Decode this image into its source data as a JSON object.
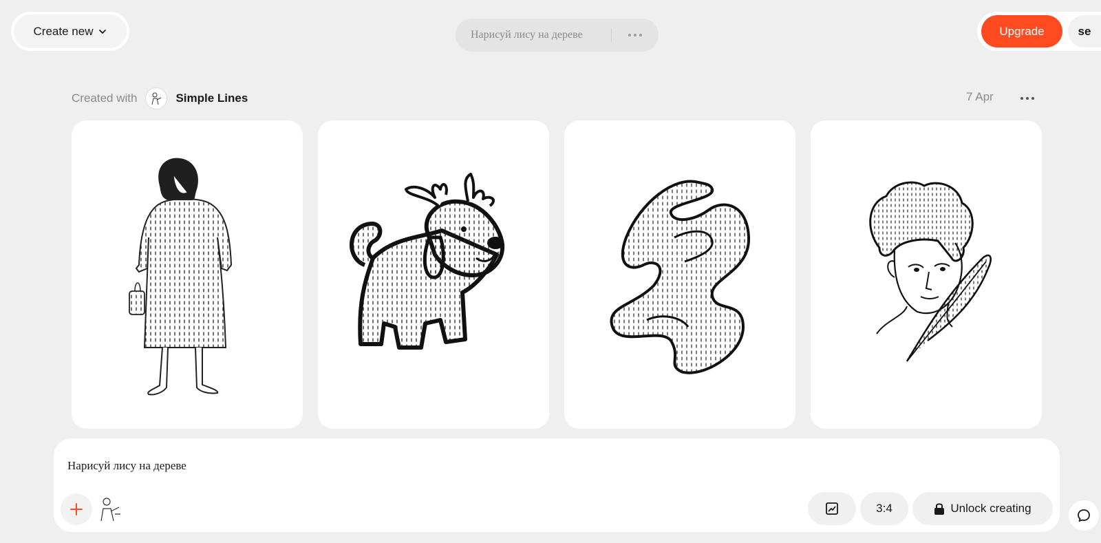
{
  "header": {
    "create_new_label": "Create new",
    "prompt_preview": "Нарисуй лису на дереве",
    "upgrade_label": "Upgrade",
    "user_initials": "se"
  },
  "generation": {
    "created_with_label": "Created with",
    "style_name": "Simple Lines",
    "date": "7 Apr"
  },
  "images": [
    {
      "subject": "woman in dotted dress holding bag"
    },
    {
      "subject": "dotted dog with antlers"
    },
    {
      "subject": "abstract dotted squiggle shape"
    },
    {
      "subject": "curly-haired woman portrait with leaf"
    }
  ],
  "composer": {
    "prompt_text": "Нарисуй лису на дереве",
    "aspect_ratio": "3:4",
    "unlock_label": "Unlock creating"
  },
  "colors": {
    "accent": "#ff4b1f",
    "background": "#efefef"
  },
  "icons": [
    "chevron-down-icon",
    "more-dots-icon",
    "plus-icon",
    "image-ratio-icon",
    "lock-icon",
    "chat-icon"
  ]
}
